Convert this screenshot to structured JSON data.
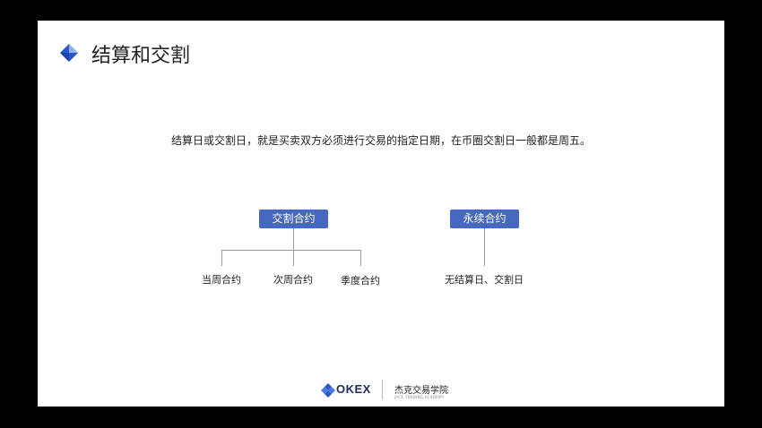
{
  "slide": {
    "title": "结算和交割",
    "description": "结算日或交割日，就是买卖双方必须进行交易的指定日期，在币圈交割日一般都是周五。"
  },
  "diagram": {
    "left": {
      "label": "交割合约",
      "children": [
        "当周合约",
        "次周合约",
        "季度合约"
      ]
    },
    "right": {
      "label": "永续合约",
      "children": [
        "无结算日、交割日"
      ]
    }
  },
  "footer": {
    "brand": "OKEX",
    "academy": "杰克交易学院",
    "academy_en": "JACK TRADING ACADEMY"
  },
  "colors": {
    "accent": "#4768c1",
    "icon_dark": "#2b56c8",
    "icon_light": "#8fb2ec",
    "background": "#000000",
    "slide": "#ffffff"
  }
}
